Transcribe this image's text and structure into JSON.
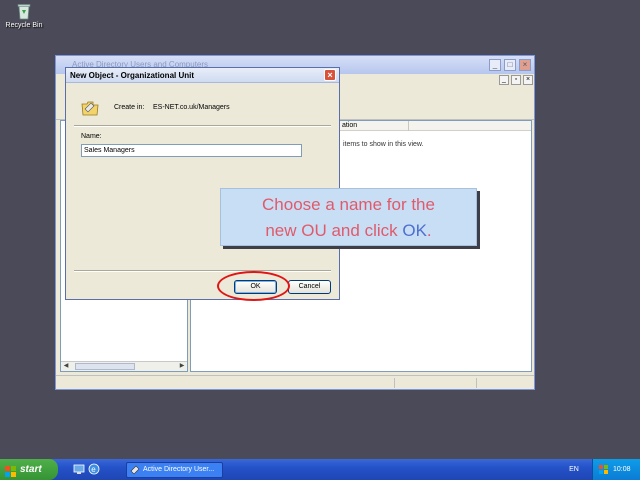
{
  "desktop": {
    "recycle_bin_label": "Recycle Bin"
  },
  "mmc_window": {
    "title": "Active Directory Users and Computers",
    "list_header_description": "ation",
    "empty_message": "items to show in this view."
  },
  "dialog": {
    "title": "New Object - Organizational Unit",
    "create_in_label": "Create in:",
    "create_in_path": "ES-NET.co.uk/Managers",
    "name_label": "Name:",
    "name_value": "Sales Managers",
    "ok_label": "OK",
    "cancel_label": "Cancel",
    "close_glyph": "×"
  },
  "callout": {
    "line1": "Choose a name for the",
    "line2_prefix": "new OU and click ",
    "line2_ok": "OK",
    "line2_suffix": "."
  },
  "taskbar": {
    "start_label": "start",
    "task_button_label": "Active Directory User...",
    "language": "EN",
    "clock": "10:08"
  },
  "colors": {
    "callout_text": "#e05a6b",
    "callout_highlight": "#4d6fd0",
    "highlight_ring": "#e01515",
    "desktop_bg": "#4a4a58"
  },
  "icons": {
    "recycle_bin": "recycle-bin-icon",
    "folder": "organizational-unit-folder-icon",
    "start_flag": "windows-flag-icon",
    "quick_launch": [
      "desktop-icon",
      "internet-explorer-icon"
    ],
    "tray": "network-icon"
  }
}
